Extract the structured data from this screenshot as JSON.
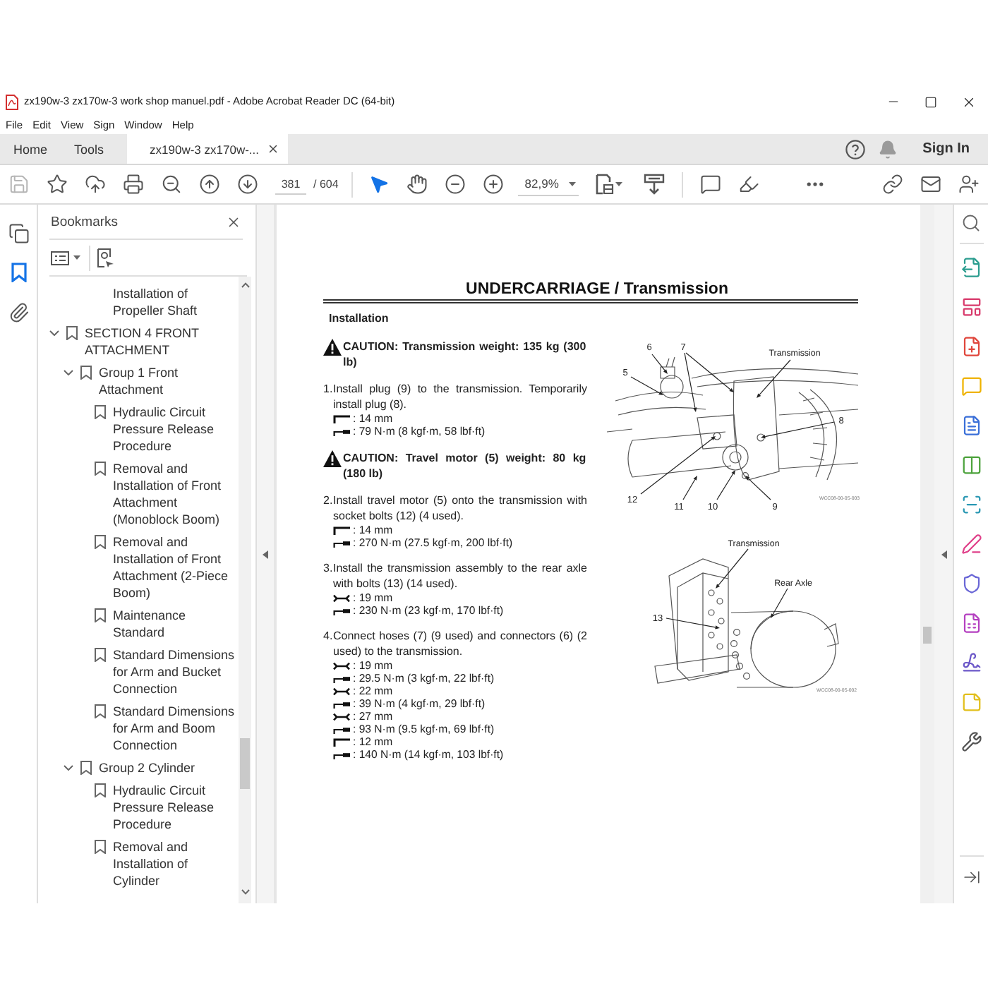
{
  "window": {
    "title": "zx190w-3 zx170w-3 work shop manuel.pdf - Adobe Acrobat Reader DC (64-bit)"
  },
  "menu": [
    "File",
    "Edit",
    "View",
    "Sign",
    "Window",
    "Help"
  ],
  "tabs": [
    {
      "label": "Home",
      "kind": "nav",
      "selected": false
    },
    {
      "label": "Tools",
      "kind": "nav",
      "selected": false
    },
    {
      "label": "zx190w-3 zx170w-...",
      "kind": "document",
      "selected": true
    }
  ],
  "account": {
    "sign_in": "Sign In"
  },
  "toolbar": {
    "save_disabled": true,
    "page_number": "381",
    "page_total": "/ 604",
    "pointer_tools": [
      {
        "kind": "select",
        "selected": true
      },
      {
        "kind": "hand",
        "selected": false
      }
    ],
    "zoom": "82,9%"
  },
  "left_rail": [
    {
      "kind": "pages",
      "selected": false
    },
    {
      "kind": "bookmarks",
      "selected": true
    },
    {
      "kind": "attachments",
      "selected": false
    }
  ],
  "bookmarks": {
    "title": "Bookmarks",
    "items": [
      {
        "label": "Installation of Propeller Shaft",
        "kind": "partial"
      },
      {
        "label": "SECTION 4 FRONT ATTACHMENT",
        "kind": "folder",
        "expanded": true,
        "children": [
          {
            "label": "Group 1 Front Attachment",
            "kind": "folder",
            "expanded": true,
            "children": [
              {
                "label": "Hydraulic Circuit Pressure Release Procedure",
                "kind": "leaf"
              },
              {
                "label": "Removal and Installation of Front Attachment (Monoblock Boom)",
                "kind": "leaf"
              },
              {
                "label": "Removal and Installation of Front Attachment (2-Piece Boom)",
                "kind": "leaf"
              },
              {
                "label": "Maintenance Standard",
                "kind": "leaf"
              },
              {
                "label": "Standard Dimensions for Arm and Bucket Connection",
                "kind": "leaf"
              },
              {
                "label": "Standard Dimensions for Arm and Boom Connection",
                "kind": "leaf"
              }
            ]
          },
          {
            "label": "Group 2 Cylinder",
            "kind": "folder",
            "expanded": true,
            "children": [
              {
                "label": "Hydraulic Circuit Pressure Release Procedure",
                "kind": "leaf"
              },
              {
                "label": "Removal and Installation of Cylinder",
                "kind": "leaf"
              }
            ]
          }
        ]
      }
    ]
  },
  "document": {
    "heading": "UNDERCARRIAGE / Transmission",
    "section": "Installation",
    "blocks": [
      {
        "kind": "caution",
        "text": "CAUTION: Transmission weight: 135 kg (300 lb)"
      },
      {
        "kind": "step",
        "number": "1.",
        "text": "Install plug (9) to the transmission. Temporarily install plug (8).",
        "tools": [
          {
            "kind": "hex_key",
            "spec": ": 14 mm"
          },
          {
            "kind": "torque_wrench",
            "spec": ": 79 N·m (8 kgf·m, 58 lbf·ft)"
          }
        ]
      },
      {
        "kind": "caution",
        "text": "CAUTION: Travel motor (5) weight: 80 kg (180 lb)"
      },
      {
        "kind": "step",
        "number": "2.",
        "text": "Install travel motor (5) onto the transmission with socket bolts (12) (4 used).",
        "tools": [
          {
            "kind": "hex_key",
            "spec": ": 14 mm"
          },
          {
            "kind": "torque_wrench",
            "spec": ": 270 N·m (27.5 kgf·m, 200 lbf·ft)"
          }
        ]
      },
      {
        "kind": "step",
        "number": "3.",
        "text": "Install the transmission assembly to the rear axle with bolts (13) (14 used).",
        "tools": [
          {
            "kind": "wrench",
            "spec": ": 19 mm"
          },
          {
            "kind": "torque_wrench",
            "spec": ": 230 N·m (23 kgf·m, 170 lbf·ft)"
          }
        ]
      },
      {
        "kind": "step",
        "number": "4.",
        "text": "Connect hoses (7) (9 used) and connectors (6) (2 used) to the transmission.",
        "tools": [
          {
            "kind": "wrench",
            "spec": ": 19 mm"
          },
          {
            "kind": "torque_wrench",
            "spec": ": 29.5 N·m (3 kgf·m, 22 lbf·ft)"
          },
          {
            "kind": "wrench",
            "spec": ": 22 mm"
          },
          {
            "kind": "torque_wrench",
            "spec": ": 39 N·m (4 kgf·m, 29 lbf·ft)"
          },
          {
            "kind": "wrench",
            "spec": ": 27 mm"
          },
          {
            "kind": "torque_wrench",
            "spec": ": 93 N·m (9.5 kgf·m, 69 lbf·ft)"
          },
          {
            "kind": "hex_key",
            "spec": ": 12 mm"
          },
          {
            "kind": "torque_wrench",
            "spec": ": 140 N·m (14 kgf·m, 103 lbf·ft)"
          }
        ]
      }
    ],
    "figures": [
      {
        "kind": "transmission",
        "callouts": [
          "6",
          "7",
          "Transmission",
          "5",
          "8",
          "12",
          "11",
          "10",
          "9"
        ],
        "code": "WCC08-00-05-003"
      },
      {
        "kind": "axle",
        "callouts": [
          "Transmission",
          "Rear Axle",
          "13"
        ],
        "code": "WCC08-00-05-002"
      }
    ]
  }
}
